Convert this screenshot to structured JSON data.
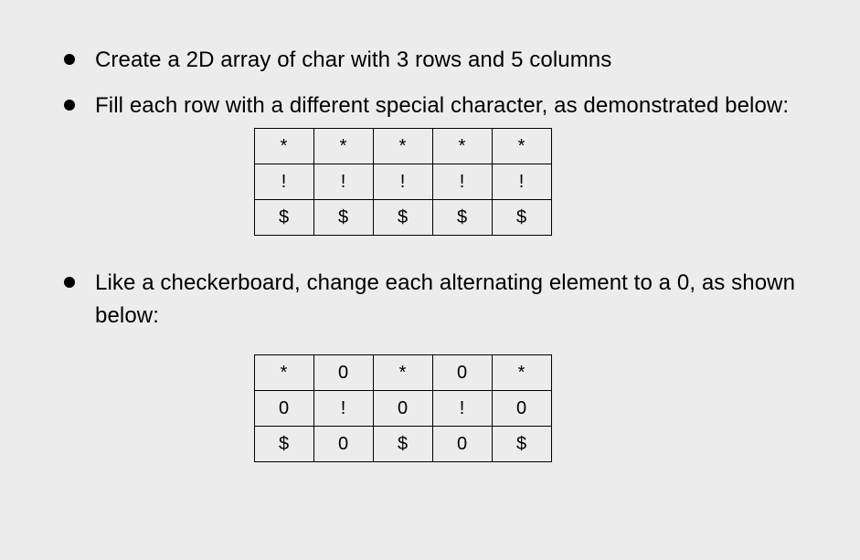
{
  "bullets": {
    "b1": "Create a 2D array of char with 3 rows and 5 columns",
    "b2": "Fill each row with a different special character, as demonstrated below:",
    "b3": "Like a checkerboard, change each alternating element to a 0, as shown below:"
  },
  "table1": {
    "rows": [
      [
        "*",
        "*",
        "*",
        "*",
        "*"
      ],
      [
        "!",
        "!",
        "!",
        "!",
        "!"
      ],
      [
        "$",
        "$",
        "$",
        "$",
        "$"
      ]
    ]
  },
  "table2": {
    "rows": [
      [
        "*",
        "0",
        "*",
        "0",
        "*"
      ],
      [
        "0",
        "!",
        "0",
        "!",
        "0"
      ],
      [
        "$",
        "0",
        "$",
        "0",
        "$"
      ]
    ]
  }
}
